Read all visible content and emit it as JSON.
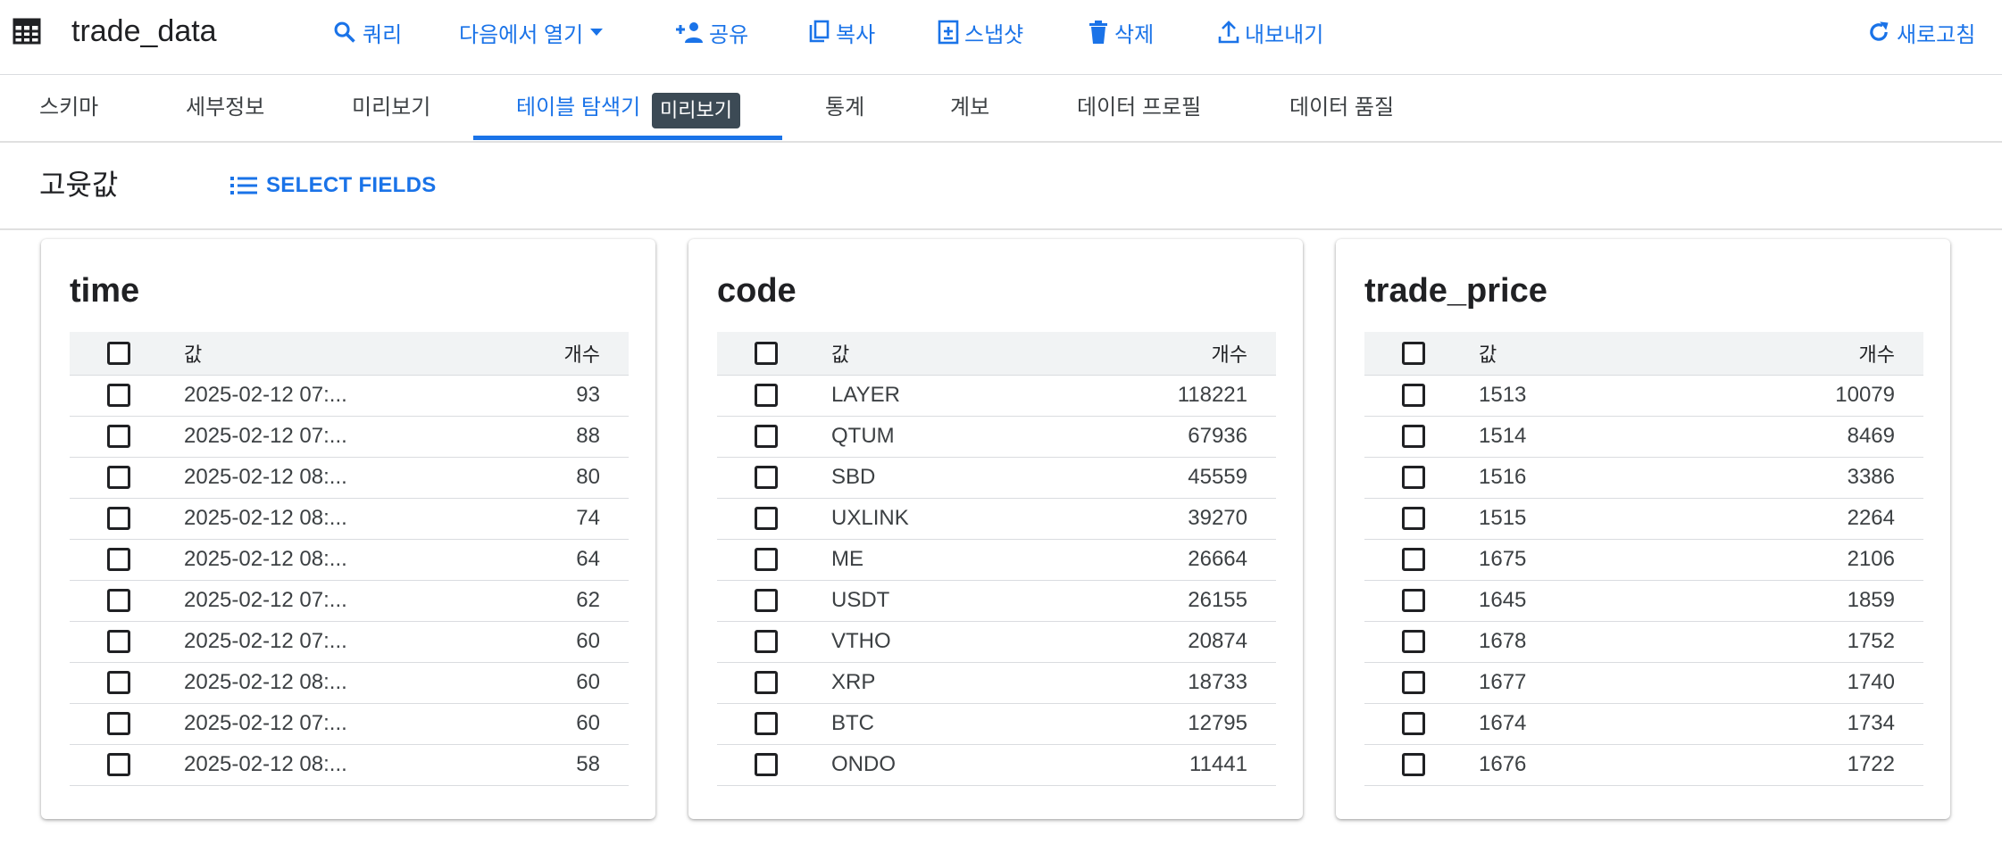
{
  "toolbar": {
    "title": "trade_data",
    "buttons": {
      "query": "쿼리",
      "open_in": "다음에서 열기",
      "share": "공유",
      "copy": "복사",
      "snapshot": "스냅샷",
      "delete": "삭제",
      "export": "내보내기",
      "refresh": "새로고침"
    }
  },
  "tabs": [
    "스키마",
    "세부정보",
    "미리보기",
    "테이블 탐색기",
    "통계",
    "계보",
    "데이터 프로필",
    "데이터 품질"
  ],
  "active_tab": "테이블 탐색기",
  "tab_badge": "미리보기",
  "section": {
    "title": "고윳값",
    "select_fields": "SELECT FIELDS"
  },
  "cards": [
    {
      "title": "time",
      "header_value": "값",
      "header_count": "개수",
      "rows": [
        {
          "value": "2025-02-12 07:...",
          "count": "93"
        },
        {
          "value": "2025-02-12 07:...",
          "count": "88"
        },
        {
          "value": "2025-02-12 08:...",
          "count": "80"
        },
        {
          "value": "2025-02-12 08:...",
          "count": "74"
        },
        {
          "value": "2025-02-12 08:...",
          "count": "64"
        },
        {
          "value": "2025-02-12 07:...",
          "count": "62"
        },
        {
          "value": "2025-02-12 07:...",
          "count": "60"
        },
        {
          "value": "2025-02-12 08:...",
          "count": "60"
        },
        {
          "value": "2025-02-12 07:...",
          "count": "60"
        },
        {
          "value": "2025-02-12 08:...",
          "count": "58"
        }
      ]
    },
    {
      "title": "code",
      "header_value": "값",
      "header_count": "개수",
      "rows": [
        {
          "value": "LAYER",
          "count": "118221"
        },
        {
          "value": "QTUM",
          "count": "67936"
        },
        {
          "value": "SBD",
          "count": "45559"
        },
        {
          "value": "UXLINK",
          "count": "39270"
        },
        {
          "value": "ME",
          "count": "26664"
        },
        {
          "value": "USDT",
          "count": "26155"
        },
        {
          "value": "VTHO",
          "count": "20874"
        },
        {
          "value": "XRP",
          "count": "18733"
        },
        {
          "value": "BTC",
          "count": "12795"
        },
        {
          "value": "ONDO",
          "count": "11441"
        }
      ]
    },
    {
      "title": "trade_price",
      "header_value": "값",
      "header_count": "개수",
      "rows": [
        {
          "value": "1513",
          "count": "10079"
        },
        {
          "value": "1514",
          "count": "8469"
        },
        {
          "value": "1516",
          "count": "3386"
        },
        {
          "value": "1515",
          "count": "2264"
        },
        {
          "value": "1675",
          "count": "2106"
        },
        {
          "value": "1645",
          "count": "1859"
        },
        {
          "value": "1678",
          "count": "1752"
        },
        {
          "value": "1677",
          "count": "1740"
        },
        {
          "value": "1674",
          "count": "1734"
        },
        {
          "value": "1676",
          "count": "1722"
        }
      ]
    }
  ],
  "colors": {
    "accent": "#1a73e8",
    "text": "#202124",
    "badge_bg": "#3c4a55",
    "divider": "#dadce0"
  }
}
